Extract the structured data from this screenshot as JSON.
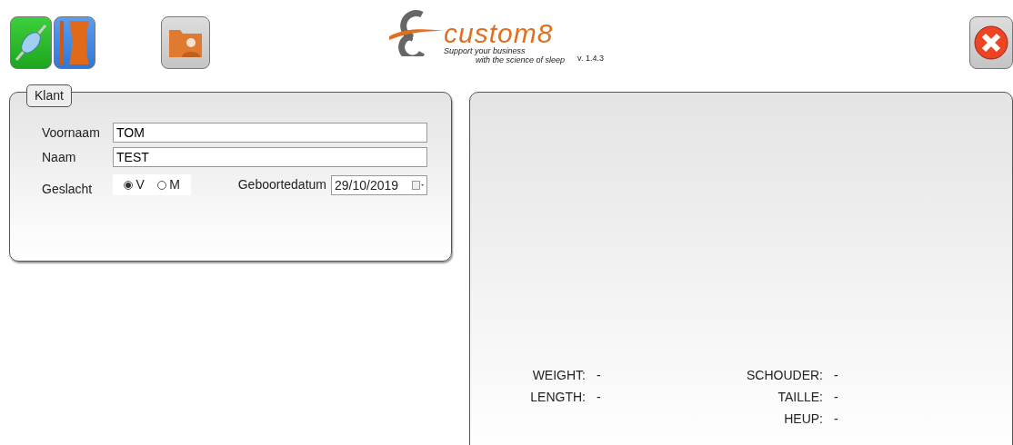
{
  "logo": {
    "brand": "custom8",
    "tagline_1": "Support your business",
    "tagline_2": "with the science of sleep",
    "version": "v. 1.4.3"
  },
  "client": {
    "legend": "Klant",
    "fields": [
      {
        "label": "Voornaam",
        "value": "TOM"
      },
      {
        "label": "Naam",
        "value": "TEST"
      }
    ],
    "gender": {
      "label": "Geslacht",
      "options": [
        {
          "label": "V",
          "selected": true
        },
        {
          "label": "M",
          "selected": false
        }
      ]
    },
    "birthdate": {
      "label": "Geboortedatum",
      "value": "29/10/2019"
    }
  },
  "measurements": {
    "left": [
      {
        "name": "WEIGHT:",
        "reading": "-"
      },
      {
        "name": "LENGTH:",
        "reading": "-"
      }
    ],
    "right": [
      {
        "name": "SCHOUDER:",
        "reading": "-"
      },
      {
        "name": "TAILLE:",
        "reading": "-"
      },
      {
        "name": "HEUP:",
        "reading": "-"
      }
    ]
  }
}
